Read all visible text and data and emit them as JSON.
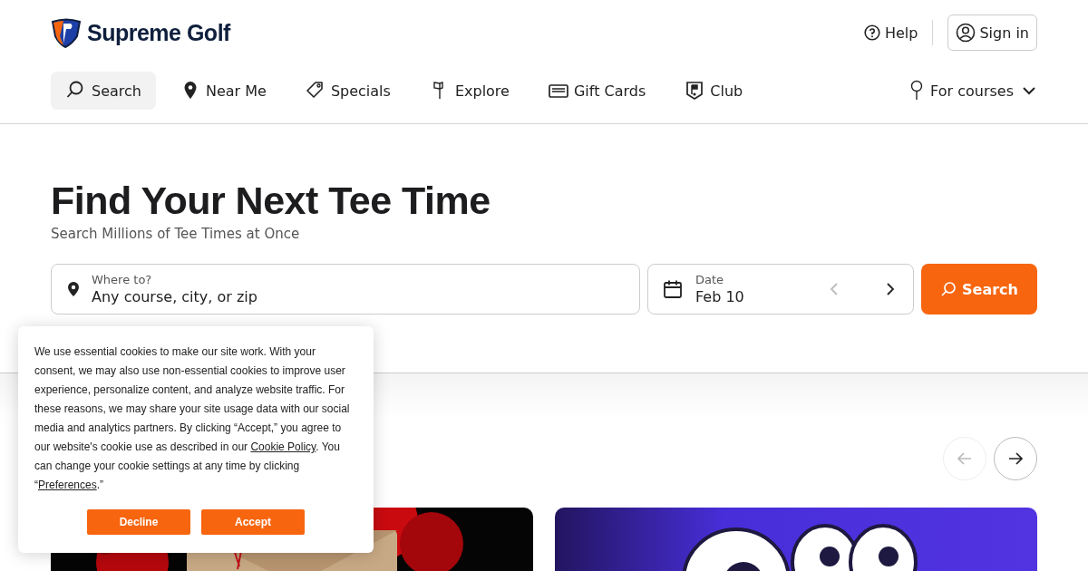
{
  "header": {
    "logo": "Supreme Golf",
    "help": "Help",
    "sign_in": "Sign in"
  },
  "nav": [
    {
      "label": "Search",
      "selected": true
    },
    {
      "label": "Near Me",
      "selected": false
    },
    {
      "label": "Specials",
      "selected": false
    },
    {
      "label": "Explore",
      "selected": false
    },
    {
      "label": "Gift Cards",
      "selected": false
    },
    {
      "label": "Club",
      "selected": false
    }
  ],
  "for_courses": "For courses",
  "hero": {
    "title": "Find Your Next Tee Time",
    "subtitle": "Search Millions of Tee Times at Once"
  },
  "search": {
    "where_label": "Where to?",
    "where_placeholder": "Any course, city, or zip",
    "date_label": "Date",
    "date_value": "Feb 10",
    "prev_disabled": true,
    "next_disabled": false,
    "button": "Search"
  },
  "carousel": {
    "prev_disabled": true,
    "next_disabled": false
  },
  "cookie": {
    "text": "We use essential cookies to make our site work. With your consent, we may also use non-essential cookies to improve user experience, personalize content, and analyze website traffic. For these reasons, we may share your site usage data with our social media and analytics partners. By clicking “Accept,” you agree to our website's cookie use as described in our ",
    "policy_link": "Cookie Policy",
    "text_2": ". You can change your cookie settings at any time by clicking “",
    "preferences_link": "Preferences",
    "text_3": ".”",
    "buttons": [
      "Decline",
      "Accept"
    ]
  }
}
